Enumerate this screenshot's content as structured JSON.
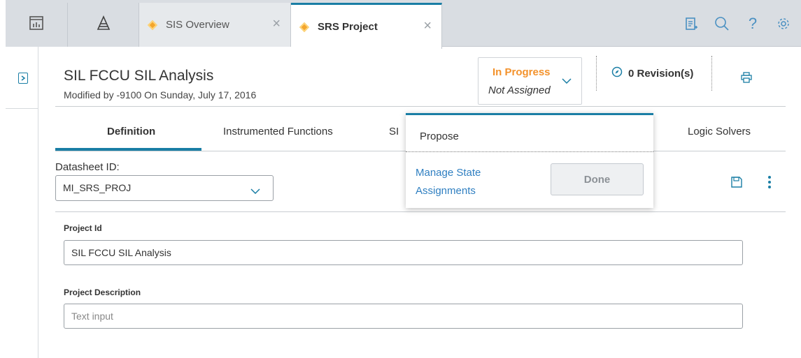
{
  "top_tabs": [
    {
      "label": "SIS Overview",
      "active": false
    },
    {
      "label": "SRS Project",
      "active": true
    }
  ],
  "top_icons": [
    "clipboard-add-icon",
    "search-icon",
    "help-icon",
    "settings-icon"
  ],
  "header": {
    "title": "SIL FCCU SIL Analysis",
    "subtitle": "Modified by -9100 On Sunday, July 17, 2016"
  },
  "state": {
    "status": "In Progress",
    "assignee": "Not Assigned"
  },
  "revisions": {
    "label": "0 Revision(s)"
  },
  "tabs": [
    {
      "label": "Definition",
      "active": true
    },
    {
      "label": "Instrumented Functions",
      "active": false
    },
    {
      "label": "SI",
      "active": false
    },
    {
      "label": "Logic Solvers",
      "active": false
    }
  ],
  "datasheet": {
    "label": "Datasheet ID:",
    "value": "MI_SRS_PROJ"
  },
  "fields": {
    "project_id_label": "Project Id",
    "project_id_value": "SIL FCCU SIL Analysis",
    "project_desc_label": "Project Description",
    "project_desc_placeholder": "Text input"
  },
  "popup": {
    "propose": "Propose",
    "manage_link": "Manage State Assignments",
    "done_label": "Done"
  },
  "colors": {
    "accent": "#1a7ea5",
    "status_orange": "#f3922c",
    "link_blue": "#2f7fc1"
  }
}
